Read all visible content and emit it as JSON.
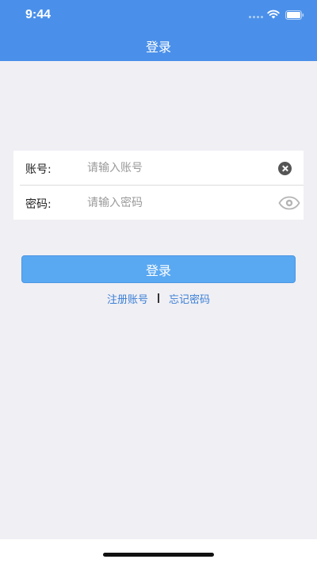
{
  "status_bar": {
    "time": "9:44"
  },
  "header": {
    "title": "登录",
    "color": "#4a90ea"
  },
  "form": {
    "account": {
      "label": "账号:",
      "placeholder": "请输入账号",
      "value": "",
      "action_icon": "clear-icon"
    },
    "password": {
      "label": "密码:",
      "placeholder": "请输入密码",
      "value": "",
      "action_icon": "eye-icon"
    }
  },
  "login_button": {
    "label": "登录",
    "color": "#59a8f2"
  },
  "links": {
    "register": "注册账号",
    "forgot": "忘记密码",
    "color": "#3a7fd5"
  }
}
